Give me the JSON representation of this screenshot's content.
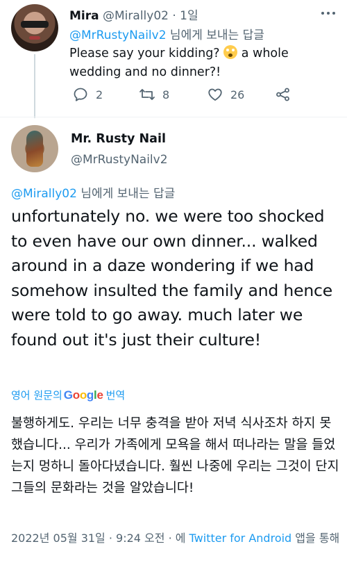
{
  "reply_tweet": {
    "author_name": "Mira",
    "author_handle": "@Mirally02",
    "time": "· 1일",
    "replying_to_mention": "@MrRustyNailv2",
    "replying_to_suffix": " 님에게 보내는 답글",
    "text_part1": "Please say your kidding? ",
    "emoji": "flushed-face-emoji",
    "text_part2": " a whole wedding and no dinner?!",
    "stats": {
      "replies": "2",
      "retweets": "8",
      "likes": "26"
    }
  },
  "main_tweet": {
    "author_name": "Mr. Rusty Nail",
    "author_handle": "@MrRustyNailv2",
    "replying_to_mention": "@Mirally02",
    "replying_to_suffix": " 님에게 보내는 답글",
    "text": "unfortunately no. we were too shocked to even have our own dinner... walked around in a daze wondering if we had somehow insulted the family and hence were told to go away. much later we found out it's just their culture!",
    "translate_prefix": "영어 원문의",
    "translate_brand": [
      "G",
      "o",
      "o",
      "g",
      "l",
      "e"
    ],
    "translate_suffix": "번역",
    "translated_text": "불행하게도. 우리는 너무 충격을 받아 저녁 식사조차 하지 못했습니다... 우리가 가족에게 모욕을 해서 떠나라는 말을 들었는지 멍하니 돌아다녔습니다. 훨씬 나중에 우리는 그것이 단지 그들의 문화라는 것을 알았습니다!",
    "timestamp": "2022년 05월 31일 · 9:24 오전 · 에 ",
    "source": "Twitter for Android",
    "source_suffix": " 앱을 통해"
  },
  "colors": {
    "link": "#1d9bf0",
    "secondary_text": "#536471",
    "primary_text": "#0f1419"
  }
}
